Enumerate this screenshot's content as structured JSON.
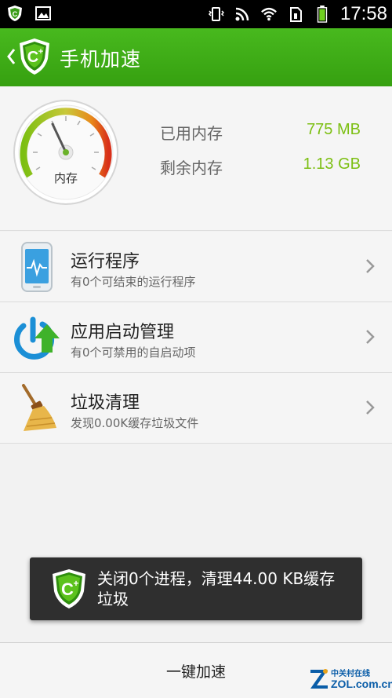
{
  "status_bar": {
    "time": "17:58",
    "icons": [
      "app-shield-icon",
      "gallery-icon",
      "vibrate-icon",
      "rss-icon",
      "wifi-icon",
      "sim-icon",
      "battery-icon"
    ]
  },
  "header": {
    "title": "手机加速",
    "back_icon": "chevron-left-icon",
    "logo_icon": "shield-plus-icon"
  },
  "memory": {
    "gauge_label": "内存",
    "used_label": "已用内存",
    "used_value": "775 MB",
    "free_label": "剩余内存",
    "free_value": "1.13 GB",
    "used_fraction": 0.4,
    "accent": "#7cbf12"
  },
  "items": [
    {
      "title": "运行程序",
      "subtitle": "有0个可结束的运行程序",
      "icon": "phone-activity-icon"
    },
    {
      "title": "应用启动管理",
      "subtitle": "有0个可禁用的自启动项",
      "icon": "power-upload-icon"
    },
    {
      "title": "垃圾清理",
      "subtitle": "发现0.00K缓存垃圾文件",
      "icon": "broom-icon"
    }
  ],
  "toast": {
    "text": "关闭0个进程，清理44.00 KB缓存垃圾"
  },
  "bottom": {
    "button_label": "一键加速"
  },
  "watermark": {
    "line1": "中关村在线",
    "line2": "ZOL.com.cn"
  },
  "colors": {
    "header_green": "#3dad14",
    "value_green": "#7cbf12",
    "toast_bg": "#2f2f2f"
  }
}
